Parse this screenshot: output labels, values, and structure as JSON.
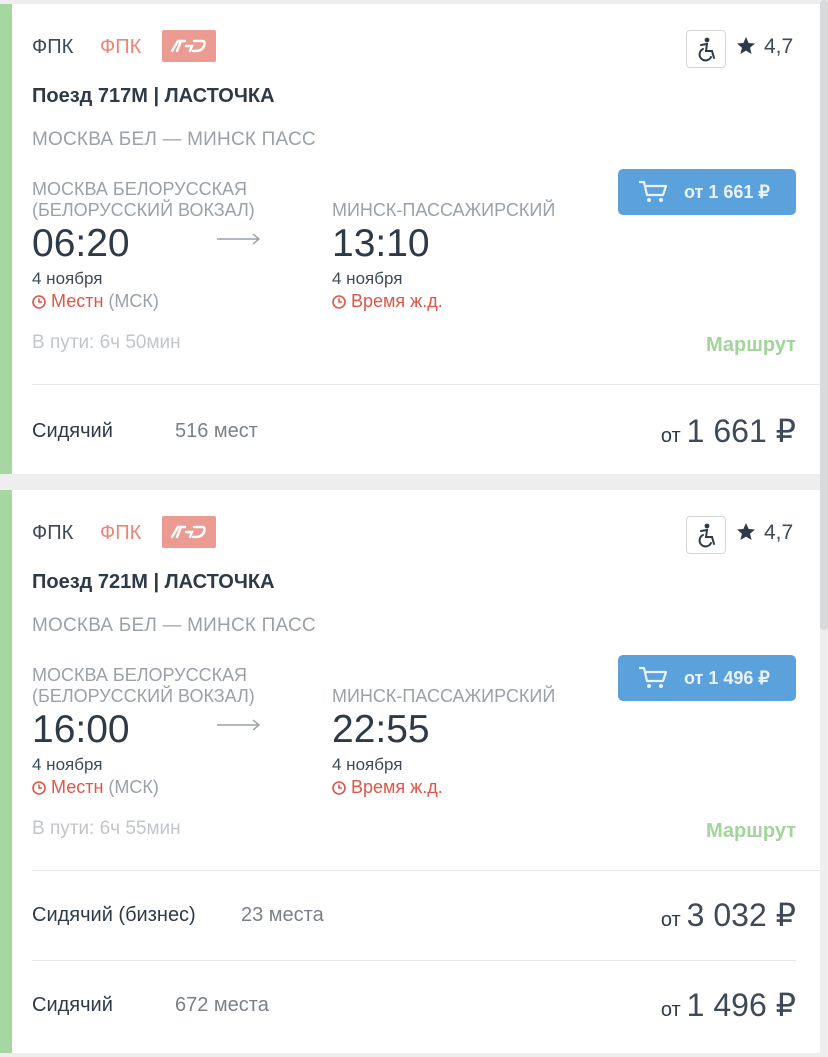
{
  "icons": {
    "wheelchair": "wheelchair-icon",
    "star": "star-icon",
    "cart": "cart-icon",
    "clock": "clock-icon",
    "arrow": "arrow-right-icon",
    "logo": "rzd-logo"
  },
  "colors": {
    "accent_green": "#a7d7a0",
    "route_link": "#a2d49b",
    "button": "#5ba2dc",
    "warning": "#e05547",
    "rzd": "#eb9b92"
  },
  "trains": [
    {
      "carrier": "ФПК",
      "carrier_accent": "ФПК",
      "rating": "4,7",
      "title": "Поезд 717М | ЛАСТОЧКА",
      "route": "МОСКВА БЕЛ — МИНСК ПАСС",
      "from_station": "МОСКВА БЕЛОРУССКАЯ (БЕЛОРУССКИЙ ВОКЗАЛ)",
      "to_station": "МИНСК-ПАССАЖИРСКИЙ",
      "dep_time": "06:20",
      "arr_time": "13:10",
      "dep_date": "4 ноября",
      "arr_date": "4 ноября",
      "dep_tz": "Местн",
      "dep_tz_sub": "(МСК)",
      "arr_tz": "Время ж.д.",
      "duration": "В пути: 6ч 50мин",
      "route_link": "Маршрут",
      "buy_label": "от 1 661 ₽",
      "seats": [
        {
          "type": "Сидячий",
          "count": "516 мест",
          "from": "от",
          "price": "1 661 ₽"
        }
      ]
    },
    {
      "carrier": "ФПК",
      "carrier_accent": "ФПК",
      "rating": "4,7",
      "title": "Поезд 721М | ЛАСТОЧКА",
      "route": "МОСКВА БЕЛ — МИНСК ПАСС",
      "from_station": "МОСКВА БЕЛОРУССКАЯ (БЕЛОРУССКИЙ ВОКЗАЛ)",
      "to_station": "МИНСК-ПАССАЖИРСКИЙ",
      "dep_time": "16:00",
      "arr_time": "22:55",
      "dep_date": "4 ноября",
      "arr_date": "4 ноября",
      "dep_tz": "Местн",
      "dep_tz_sub": "(МСК)",
      "arr_tz": "Время ж.д.",
      "duration": "В пути: 6ч 55мин",
      "route_link": "Маршрут",
      "buy_label": "от 1 496 ₽",
      "seats": [
        {
          "type": "Сидячий (бизнес)",
          "count": "23 места",
          "from": "от",
          "price": "3 032 ₽"
        },
        {
          "type": "Сидячий",
          "count": "672 места",
          "from": "от",
          "price": "1 496 ₽"
        }
      ]
    }
  ]
}
